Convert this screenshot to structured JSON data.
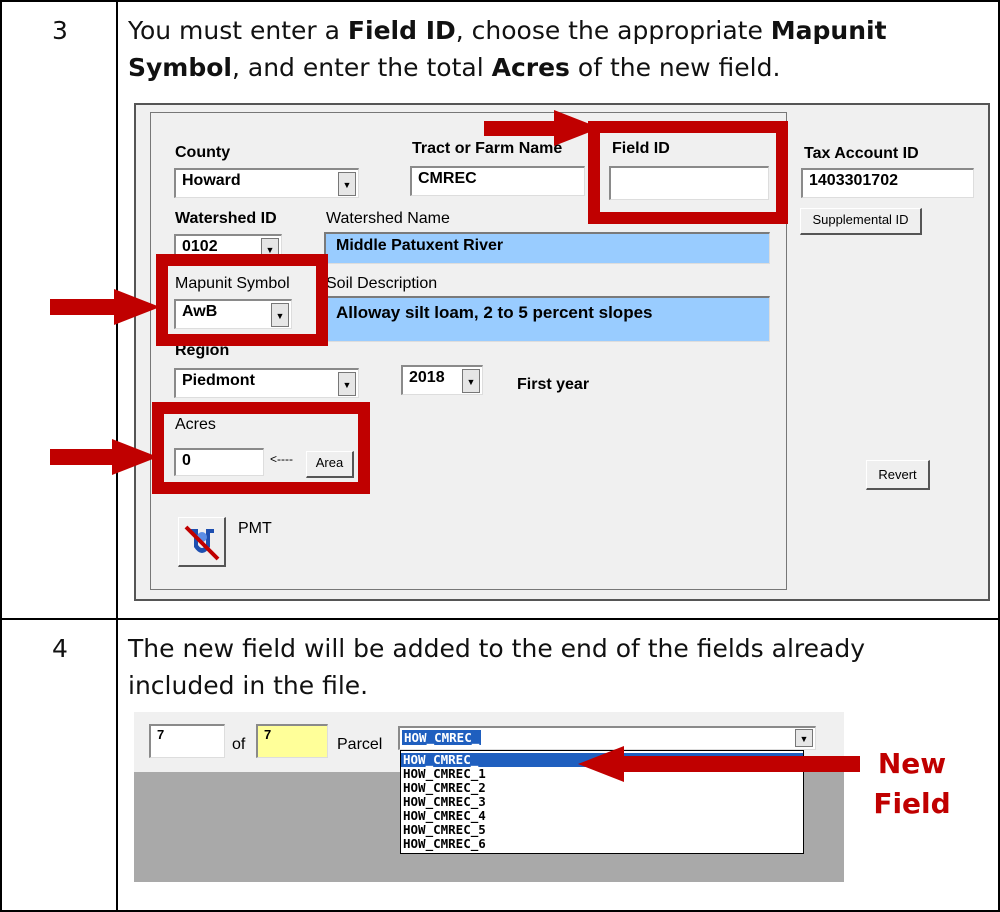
{
  "step3": {
    "number": "3",
    "text_parts": [
      "You must enter a ",
      "Field ID",
      ", choose the appropriate ",
      "Mapunit Symbol",
      ", and enter the total ",
      "Acres",
      " of the new field."
    ],
    "form": {
      "county_label": "County",
      "county_value": "Howard",
      "tract_label": "Tract or Farm Name",
      "tract_value": "CMREC",
      "field_id_label": "Field ID",
      "field_id_value": "",
      "tax_label": "Tax Account ID",
      "tax_value": "1403301702",
      "supplemental_label": "Supplemental ID",
      "watershed_id_label": "Watershed ID",
      "watershed_id_value": "0102",
      "watershed_name_label": "Watershed Name",
      "watershed_name_value": "Middle Patuxent River",
      "mapunit_label": "Mapunit Symbol",
      "mapunit_value": "AwB",
      "soil_label": "Soil Description",
      "soil_value": "Alloway silt loam, 2 to 5 percent slopes",
      "region_label": "Region",
      "region_value": "Piedmont",
      "year_value": "2018",
      "first_year_label": "First year",
      "acres_label": "Acres",
      "acres_value": "0",
      "arrow_text": "<----",
      "area_button": "Area",
      "revert_button": "Revert",
      "pmt_label": "PMT"
    }
  },
  "step4": {
    "number": "4",
    "text": "The new field will be added to the end of the fields already included in the file.",
    "record_index": "7",
    "of_label": "of",
    "record_total": "7",
    "parcel_label": "Parcel",
    "parcel_value": "HOW_CMREC_",
    "options": [
      "HOW_CMREC_",
      "HOW_CMREC_1",
      "HOW_CMREC_2",
      "HOW_CMREC_3",
      "HOW_CMREC_4",
      "HOW_CMREC_5",
      "HOW_CMREC_6"
    ],
    "new_field_label": "New Field"
  },
  "colors": {
    "highlight_red": "#c00000",
    "field_blue": "#99ccff",
    "selection_blue": "#1f5fbf",
    "yellow_field": "#ffff99"
  }
}
